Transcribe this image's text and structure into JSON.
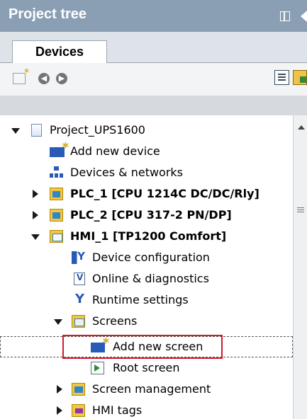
{
  "panel": {
    "title": "Project tree"
  },
  "tabs": [
    {
      "label": "Devices"
    }
  ],
  "toolbar": {
    "icons": [
      "new-folder-icon",
      "back-icon",
      "forward-icon",
      "overview-icon",
      "details-view-icon"
    ]
  },
  "tree": {
    "items": [
      {
        "label": "Project_UPS1600",
        "icon": "project-icon",
        "bold": false
      },
      {
        "label": "Add new device",
        "icon": "add-device-icon",
        "bold": false
      },
      {
        "label": "Devices & networks",
        "icon": "network-icon",
        "bold": false
      },
      {
        "label": "PLC_1 [CPU 1214C DC/DC/Rly]",
        "icon": "plc-icon",
        "bold": true
      },
      {
        "label": "PLC_2 [CPU 317-2 PN/DP]",
        "icon": "plc-icon",
        "bold": true
      },
      {
        "label": "HMI_1 [TP1200 Comfort]",
        "icon": "hmi-icon",
        "bold": true
      },
      {
        "label": "Device configuration",
        "icon": "device-config-icon",
        "bold": false
      },
      {
        "label": "Online & diagnostics",
        "icon": "online-diagnostics-icon",
        "bold": false
      },
      {
        "label": "Runtime settings",
        "icon": "runtime-settings-icon",
        "bold": false
      },
      {
        "label": "Screens",
        "icon": "folder-icon",
        "bold": false
      },
      {
        "label": "Add new screen",
        "icon": "add-screen-icon",
        "bold": false,
        "selected": true,
        "highlighted": true
      },
      {
        "label": "Root screen",
        "icon": "screen-icon",
        "bold": false
      },
      {
        "label": "Screen management",
        "icon": "screen-management-icon",
        "bold": false
      },
      {
        "label": "HMI tags",
        "icon": "hmi-tags-icon",
        "bold": false
      }
    ]
  },
  "colors": {
    "titlebar": "#8a9fb4",
    "highlight": "#d01c2e"
  }
}
